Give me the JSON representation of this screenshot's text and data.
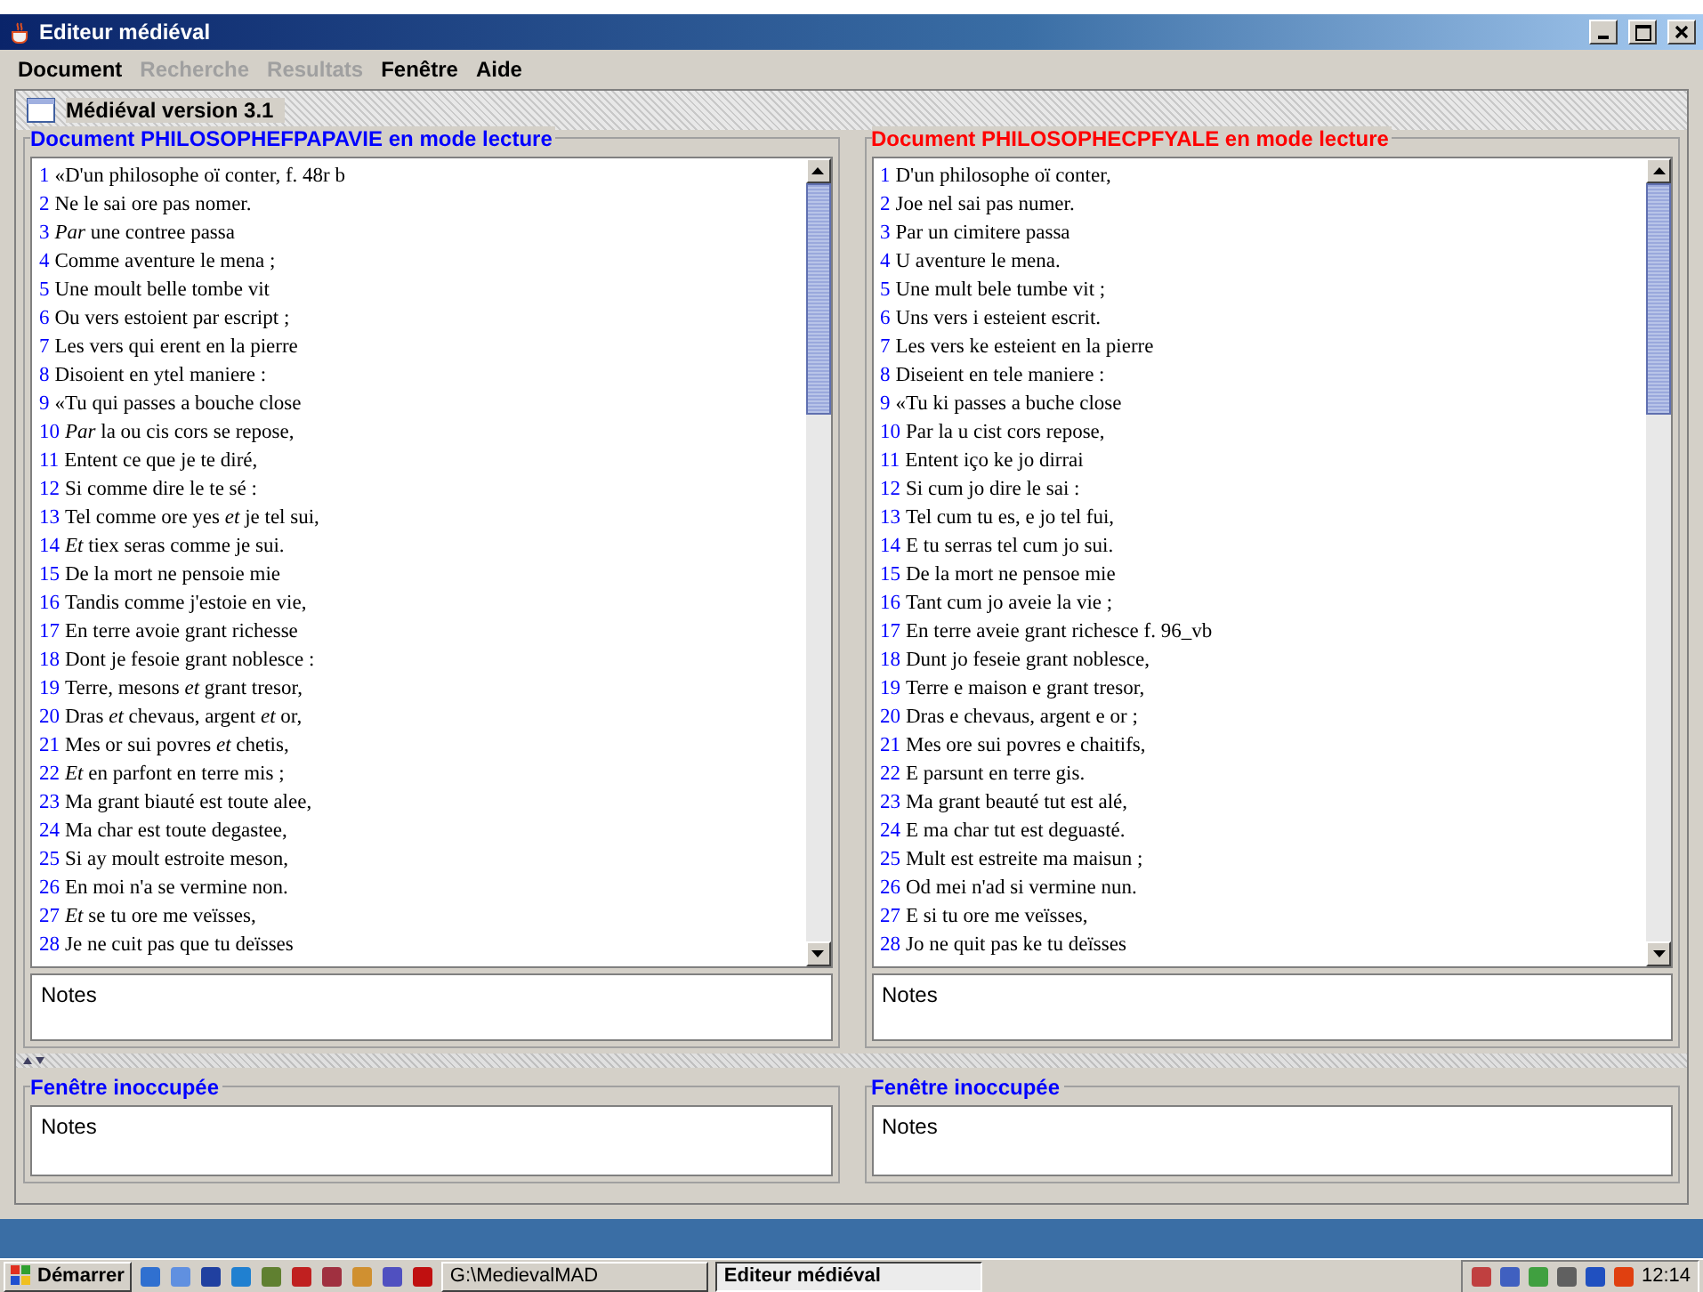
{
  "window": {
    "title": "Editeur médiéval"
  },
  "menu": [
    {
      "label": "Document",
      "disabled": false
    },
    {
      "label": "Recherche",
      "disabled": true
    },
    {
      "label": "Resultats",
      "disabled": true
    },
    {
      "label": "Fenêtre",
      "disabled": false
    },
    {
      "label": "Aide",
      "disabled": false
    }
  ],
  "internal_frame": {
    "title": "Médiéval version 3.1"
  },
  "documents": [
    {
      "title": "Document PHILOSOPHEFPAPAVIE en mode lecture",
      "color": "#0000ff",
      "notes": "Notes",
      "lines": [
        {
          "number": "1",
          "text": "«D'un philosophe oï conter, f. 48r b"
        },
        {
          "number": "2",
          "text": "Ne le sai ore pas nomer."
        },
        {
          "number": "3",
          "text": "*Par* une contree passa"
        },
        {
          "number": "4",
          "text": "Comme aventure le mena ;"
        },
        {
          "number": "5",
          "text": "Une moult belle tombe vit"
        },
        {
          "number": "6",
          "text": "Ou vers estoient par escript ;"
        },
        {
          "number": "7",
          "text": "Les vers qui erent en la pierre"
        },
        {
          "number": "8",
          "text": "Disoient en ytel maniere :"
        },
        {
          "number": "9",
          "text": "«Tu qui passes a bouche close"
        },
        {
          "number": "10",
          "text": "*Par* la ou cis cors se repose,"
        },
        {
          "number": "11",
          "text": "Entent ce que je te diré,"
        },
        {
          "number": "12",
          "text": "Si comme dire le te sé :"
        },
        {
          "number": "13",
          "text": "Tel comme ore yes *et* je tel sui,"
        },
        {
          "number": "14",
          "text": "*Et* tiex seras comme je sui."
        },
        {
          "number": "15",
          "text": "De la mort ne pensoie mie"
        },
        {
          "number": "16",
          "text": "Tandis comme j'estoie en vie,"
        },
        {
          "number": "17",
          "text": "En terre avoie grant richesse"
        },
        {
          "number": "18",
          "text": "Dont je fesoie grant noblesce :"
        },
        {
          "number": "19",
          "text": "Terre, mesons *et* grant tresor,"
        },
        {
          "number": "20",
          "text": "Dras *et* chevaus, argent *et* or,"
        },
        {
          "number": "21",
          "text": "Mes or sui povres *et* chetis,"
        },
        {
          "number": "22",
          "text": "*Et* en parfont en terre mis ;"
        },
        {
          "number": "23",
          "text": "Ma grant biauté est toute alee,"
        },
        {
          "number": "24",
          "text": "Ma char est toute degastee,"
        },
        {
          "number": "25",
          "text": "Si ay moult estroite meson,"
        },
        {
          "number": "26",
          "text": "En moi n'a se vermine non."
        },
        {
          "number": "27",
          "text": "*Et* se tu ore me veïsses,"
        },
        {
          "number": "28",
          "text": "Je ne cuit pas que tu deïsses"
        }
      ]
    },
    {
      "title": "Document PHILOSOPHECPFYALE en mode lecture",
      "color": "#ff0000",
      "notes": "Notes",
      "lines": [
        {
          "number": "1",
          "text": "D'un philosophe oï conter,"
        },
        {
          "number": "2",
          "text": "Joe nel sai pas numer."
        },
        {
          "number": "3",
          "text": "Par un cimitere passa"
        },
        {
          "number": "4",
          "text": "U aventure le mena."
        },
        {
          "number": "5",
          "text": "Une mult bele tumbe vit ;"
        },
        {
          "number": "6",
          "text": "Uns vers i esteient escrit."
        },
        {
          "number": "7",
          "text": "Les vers ke esteient en la pierre"
        },
        {
          "number": "8",
          "text": "Diseient en tele maniere :"
        },
        {
          "number": "9",
          "text": "«Tu ki passes a buche close"
        },
        {
          "number": "10",
          "text": "Par la u cist cors repose,"
        },
        {
          "number": "11",
          "text": "Entent iço ke jo dirrai"
        },
        {
          "number": "12",
          "text": "Si cum jo dire le sai :"
        },
        {
          "number": "13",
          "text": "Tel cum tu es, e jo tel fui,"
        },
        {
          "number": "14",
          "text": "E tu serras tel cum jo sui."
        },
        {
          "number": "15",
          "text": "De la mort ne pensoe mie"
        },
        {
          "number": "16",
          "text": "Tant cum jo aveie la vie ;"
        },
        {
          "number": "17",
          "text": "En terre aveie grant richesce f. 96_vb"
        },
        {
          "number": "18",
          "text": "Dunt jo feseie grant noblesce,"
        },
        {
          "number": "19",
          "text": "Terre e maison e grant tresor,"
        },
        {
          "number": "20",
          "text": "Dras e chevaus, argent e or ;"
        },
        {
          "number": "21",
          "text": "Mes ore sui povres e chaitifs,"
        },
        {
          "number": "22",
          "text": "E parsunt en terre gis."
        },
        {
          "number": "23",
          "text": "Ma grant beauté tut est alé,"
        },
        {
          "number": "24",
          "text": "E ma char tut est deguasté."
        },
        {
          "number": "25",
          "text": "Mult est estreite ma maisun ;"
        },
        {
          "number": "26",
          "text": "Od mei n'ad si vermine nun."
        },
        {
          "number": "27",
          "text": "E si tu ore me veïsses,"
        },
        {
          "number": "28",
          "text": "Jo ne quit pas ke tu deïsses"
        }
      ]
    }
  ],
  "idle_windows": [
    {
      "title": "Fenêtre inoccupée",
      "notes": "Notes"
    },
    {
      "title": "Fenêtre inoccupée",
      "notes": "Notes"
    }
  ],
  "taskbar": {
    "start": "Démarrer",
    "tasks": [
      {
        "label": "G:\\MedievalMAD",
        "selected": false
      },
      {
        "label": "Editeur médiéval",
        "selected": true
      }
    ],
    "clock": "12:14"
  }
}
